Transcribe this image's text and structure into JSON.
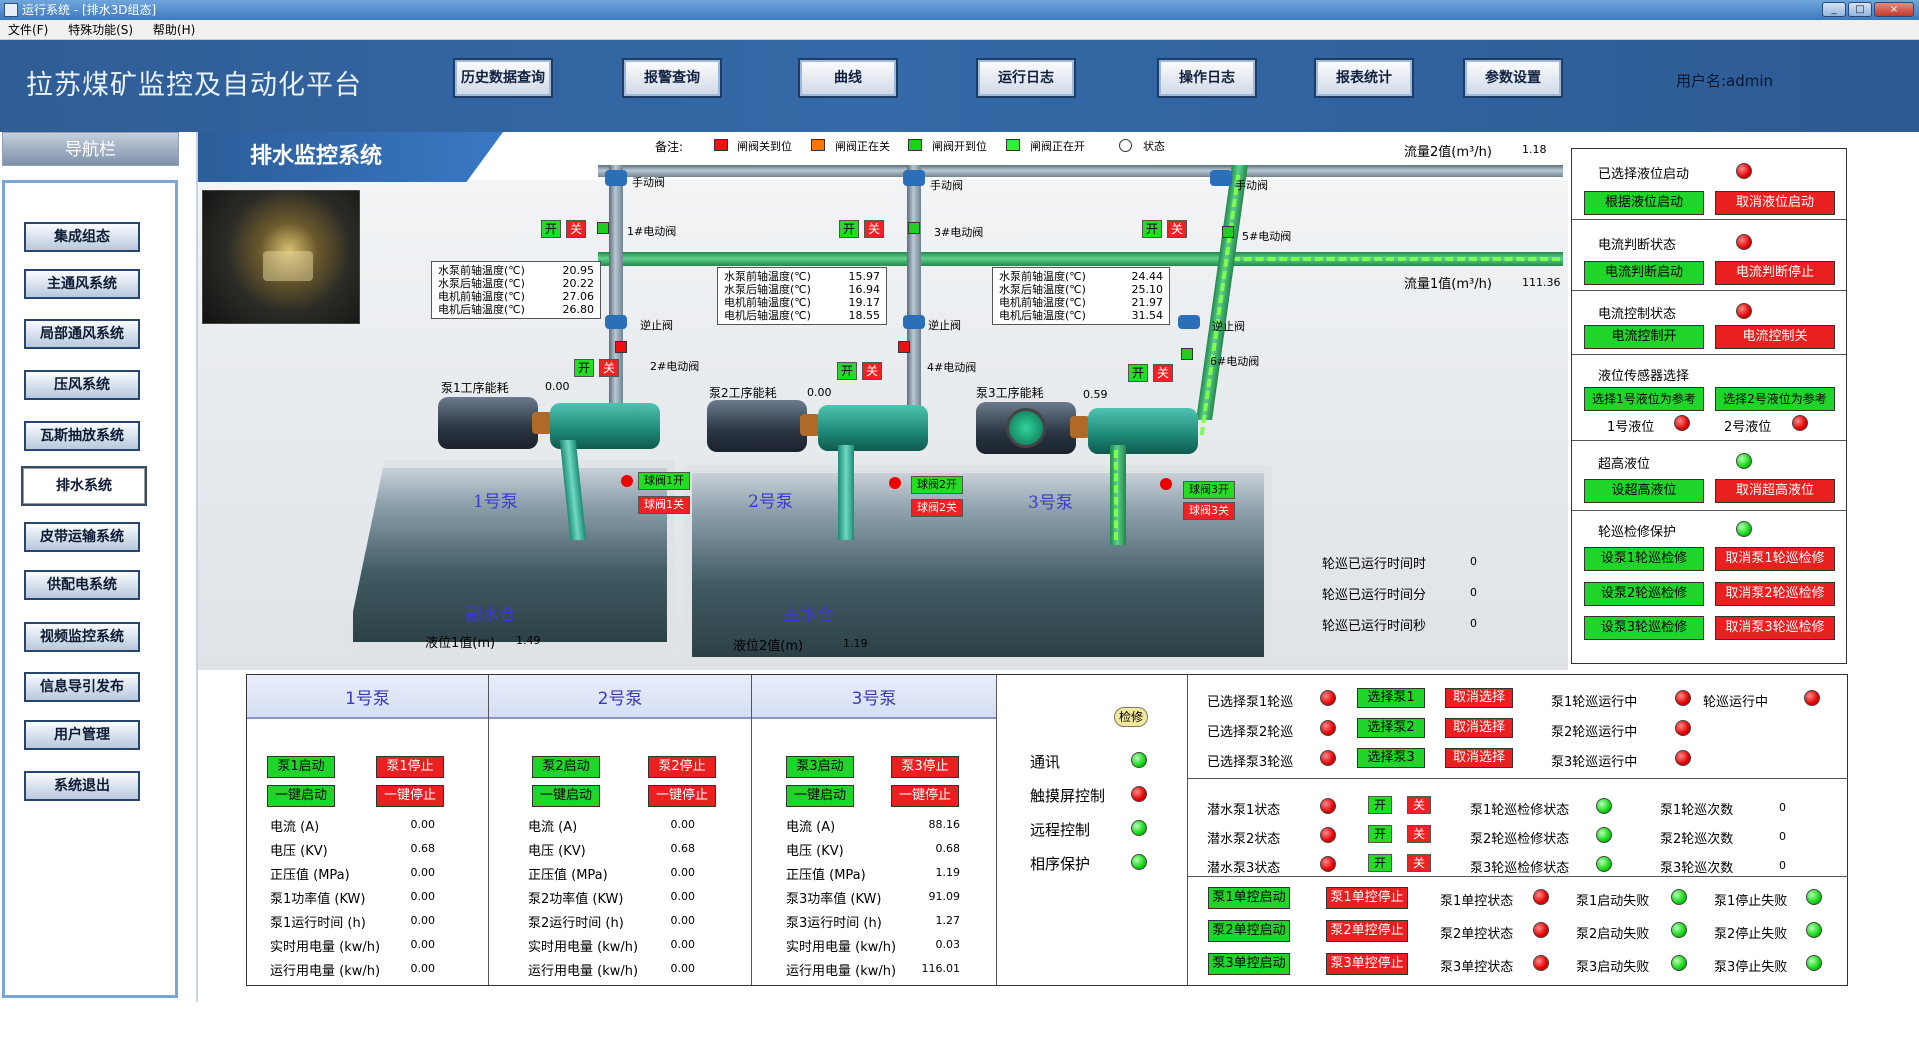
{
  "window": {
    "title": "运行系统 - [排水3D组态]",
    "controls": [
      "_",
      "□",
      "×"
    ]
  },
  "menu": [
    "文件(F)",
    "特殊功能(S)",
    "帮助(H)"
  ],
  "header": {
    "app_title": "拉苏煤矿监控及自动化平台",
    "buttons": [
      "历史数据查询",
      "报警查询",
      "曲线",
      "运行日志",
      "操作日志",
      "报表统计",
      "参数设置"
    ],
    "username": "用户名:admin"
  },
  "nav": {
    "title": "导航栏",
    "items": [
      "集成组态",
      "主通风系统",
      "局部通风系统",
      "压风系统",
      "瓦斯抽放系统",
      "排水系统",
      "皮带运输系统",
      "供配电系统",
      "视频监控系统",
      "信息导引发布",
      "用户管理",
      "系统退出"
    ],
    "active": "排水系统"
  },
  "section_title": "排水监控系统",
  "legend": {
    "prefix": "备注:",
    "items": [
      {
        "label": "闸阀关到位",
        "color": "#ee1111"
      },
      {
        "label": "闸阀正在关",
        "color": "#ff7700"
      },
      {
        "label": "闸阀开到位",
        "color": "#22cc22"
      },
      {
        "label": "闸阀正在开",
        "color": "#33ee33"
      },
      {
        "label": "状态",
        "color": "#ffffff"
      }
    ]
  },
  "flow": {
    "flow2_label": "流量2值(m³/h)",
    "flow2_value": "1.18",
    "flow1_label": "流量1值(m³/h)",
    "flow1_value": "111.36"
  },
  "scene": {
    "manual_valve": "手动阀",
    "check_valve": "逆止阀",
    "open": "开",
    "close": "关",
    "valves": [
      "1#电动阀",
      "2#电动阀",
      "3#电动阀",
      "4#电动阀",
      "5#电动阀",
      "6#电动阀"
    ],
    "pumps": [
      {
        "name": "1号泵",
        "energy_label": "泵1工序能耗",
        "energy": "0.00",
        "ball_open": "球阀1开",
        "ball_close": "球阀1关",
        "temps": [
          [
            "水泵前轴温度(℃)",
            "20.95"
          ],
          [
            "水泵后轴温度(℃)",
            "20.22"
          ],
          [
            "电机前轴温度(℃)",
            "27.06"
          ],
          [
            "电机后轴温度(℃)",
            "26.80"
          ]
        ]
      },
      {
        "name": "2号泵",
        "energy_label": "泵2工序能耗",
        "energy": "0.00",
        "ball_open": "球阀2开",
        "ball_close": "球阀2关",
        "temps": [
          [
            "水泵前轴温度(℃)",
            "15.97"
          ],
          [
            "水泵后轴温度(℃)",
            "16.94"
          ],
          [
            "电机前轴温度(℃)",
            "19.17"
          ],
          [
            "电机后轴温度(℃)",
            "18.55"
          ]
        ]
      },
      {
        "name": "3号泵",
        "energy_label": "泵3工序能耗",
        "energy": "0.59",
        "ball_open": "球阀3开",
        "ball_close": "球阀3关",
        "temps": [
          [
            "水泵前轴温度(℃)",
            "24.44"
          ],
          [
            "水泵后轴温度(℃)",
            "25.10"
          ],
          [
            "电机前轴温度(℃)",
            "21.97"
          ],
          [
            "电机后轴温度(℃)",
            "31.54"
          ]
        ]
      }
    ],
    "tanks": [
      {
        "name": "副水仓",
        "level_label": "液位1值(m)",
        "level": "1.49"
      },
      {
        "name": "主水仓",
        "level_label": "液位2值(m)",
        "level": "1.19"
      }
    ],
    "rotation": [
      {
        "label": "轮巡已运行时间时",
        "value": "0"
      },
      {
        "label": "轮巡已运行时间分",
        "value": "0"
      },
      {
        "label": "轮巡已运行时间秒",
        "value": "0"
      }
    ]
  },
  "right_panel": {
    "level_start": {
      "label": "已选择液位启动",
      "btn_on": "根据液位启动",
      "btn_off": "取消液位启动"
    },
    "current_judge": {
      "label": "电流判断状态",
      "btn_on": "电流判断启动",
      "btn_off": "电流判断停止"
    },
    "current_ctrl": {
      "label": "电流控制状态",
      "btn_on": "电流控制开",
      "btn_off": "电流控制关"
    },
    "sensor": {
      "label": "液位传感器选择",
      "btn1": "选择1号液位为参考",
      "btn2": "选择2号液位为参考",
      "lv1": "1号液位",
      "lv2": "2号液位"
    },
    "high_level": {
      "label": "超高液位",
      "btn_on": "设超高液位",
      "btn_off": "取消超高液位"
    },
    "rotation_protect": {
      "label": "轮巡检修保护",
      "set": [
        "设泵1轮巡检修",
        "设泵2轮巡检修",
        "设泵3轮巡检修"
      ],
      "cancel": [
        "取消泵1轮巡检修",
        "取消泵2轮巡检修",
        "取消泵3轮巡检修"
      ]
    }
  },
  "bottom": {
    "pumps": [
      {
        "title": "1号泵",
        "start": "泵1启动",
        "stop": "泵1停止",
        "one_start": "一键启动",
        "one_stop": "一键停止",
        "rows": [
          [
            "电流 (A)",
            "0.00"
          ],
          [
            "电压 (KV)",
            "0.68"
          ],
          [
            "正压值 (MPa)",
            "0.00"
          ],
          [
            "泵1功率值 (KW)",
            "0.00"
          ],
          [
            "泵1运行时间 (h)",
            "0.00"
          ],
          [
            "实时用电量 (kw/h)",
            "0.00"
          ],
          [
            "运行用电量 (kw/h)",
            "0.00"
          ]
        ]
      },
      {
        "title": "2号泵",
        "start": "泵2启动",
        "stop": "泵2停止",
        "one_start": "一键启动",
        "one_stop": "一键停止",
        "rows": [
          [
            "电流 (A)",
            "0.00"
          ],
          [
            "电压 (KV)",
            "0.68"
          ],
          [
            "正压值 (MPa)",
            "0.00"
          ],
          [
            "泵2功率值 (KW)",
            "0.00"
          ],
          [
            "泵2运行时间 (h)",
            "0.00"
          ],
          [
            "实时用电量 (kw/h)",
            "0.00"
          ],
          [
            "运行用电量 (kw/h)",
            "0.00"
          ]
        ]
      },
      {
        "title": "3号泵",
        "start": "泵3启动",
        "stop": "泵3停止",
        "one_start": "一键启动",
        "one_stop": "一键停止",
        "rows": [
          [
            "电流 (A)",
            "88.16"
          ],
          [
            "电压 (KV)",
            "0.68"
          ],
          [
            "正压值 (MPa)",
            "1.19"
          ],
          [
            "泵3功率值 (KW)",
            "91.09"
          ],
          [
            "泵3运行时间 (h)",
            "1.27"
          ],
          [
            "实时用电量 (kw/h)",
            "0.03"
          ],
          [
            "运行用电量 (kw/h)",
            "116.01"
          ]
        ]
      }
    ],
    "status": {
      "overhaul": "检修",
      "items": [
        "通讯",
        "触摸屏控制",
        "远程控制",
        "相序保护"
      ]
    },
    "rotation_select": {
      "rows": [
        {
          "label": "已选择泵1轮巡",
          "select": "选择泵1",
          "cancel": "取消选择",
          "state": "泵1轮巡运行中"
        },
        {
          "label": "已选择泵2轮巡",
          "select": "选择泵2",
          "cancel": "取消选择",
          "state": "泵2轮巡运行中"
        },
        {
          "label": "已选择泵3轮巡",
          "select": "选择泵3",
          "cancel": "取消选择",
          "state": "泵3轮巡运行中"
        }
      ],
      "running": "轮巡运行中"
    },
    "submersible": [
      {
        "label": "潜水泵1状态",
        "open": "开",
        "close": "关",
        "check": "泵1轮巡检修状态",
        "count_label": "泵1轮巡次数",
        "count": "0"
      },
      {
        "label": "潜水泵2状态",
        "open": "开",
        "close": "关",
        "check": "泵2轮巡检修状态",
        "count_label": "泵2轮巡次数",
        "count": "0"
      },
      {
        "label": "潜水泵3状态",
        "open": "开",
        "close": "关",
        "check": "泵3轮巡检修状态",
        "count_label": "泵3轮巡次数",
        "count": "0"
      }
    ],
    "single_ctrl": [
      {
        "start": "泵1单控启动",
        "stop": "泵1单控停止",
        "state": "泵1单控状态",
        "start_fail": "泵1启动失败",
        "stop_fail": "泵1停止失败"
      },
      {
        "start": "泵2单控启动",
        "stop": "泵2单控停止",
        "state": "泵2单控状态",
        "start_fail": "泵2启动失败",
        "stop_fail": "泵2停止失败"
      },
      {
        "start": "泵3单控启动",
        "stop": "泵3单控停止",
        "state": "泵3单控状态",
        "start_fail": "泵3启动失败",
        "stop_fail": "泵3停止失败"
      }
    ]
  }
}
